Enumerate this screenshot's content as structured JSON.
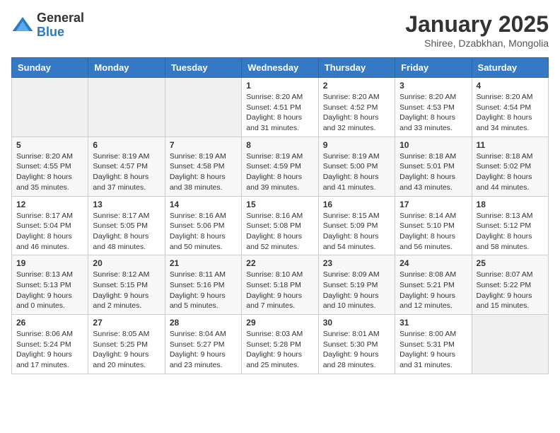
{
  "header": {
    "logo_general": "General",
    "logo_blue": "Blue",
    "month_title": "January 2025",
    "subtitle": "Shiree, Dzabkhan, Mongolia"
  },
  "days_of_week": [
    "Sunday",
    "Monday",
    "Tuesday",
    "Wednesday",
    "Thursday",
    "Friday",
    "Saturday"
  ],
  "weeks": [
    [
      {
        "day": "",
        "info": ""
      },
      {
        "day": "",
        "info": ""
      },
      {
        "day": "",
        "info": ""
      },
      {
        "day": "1",
        "info": "Sunrise: 8:20 AM\nSunset: 4:51 PM\nDaylight: 8 hours\nand 31 minutes."
      },
      {
        "day": "2",
        "info": "Sunrise: 8:20 AM\nSunset: 4:52 PM\nDaylight: 8 hours\nand 32 minutes."
      },
      {
        "day": "3",
        "info": "Sunrise: 8:20 AM\nSunset: 4:53 PM\nDaylight: 8 hours\nand 33 minutes."
      },
      {
        "day": "4",
        "info": "Sunrise: 8:20 AM\nSunset: 4:54 PM\nDaylight: 8 hours\nand 34 minutes."
      }
    ],
    [
      {
        "day": "5",
        "info": "Sunrise: 8:20 AM\nSunset: 4:55 PM\nDaylight: 8 hours\nand 35 minutes."
      },
      {
        "day": "6",
        "info": "Sunrise: 8:19 AM\nSunset: 4:57 PM\nDaylight: 8 hours\nand 37 minutes."
      },
      {
        "day": "7",
        "info": "Sunrise: 8:19 AM\nSunset: 4:58 PM\nDaylight: 8 hours\nand 38 minutes."
      },
      {
        "day": "8",
        "info": "Sunrise: 8:19 AM\nSunset: 4:59 PM\nDaylight: 8 hours\nand 39 minutes."
      },
      {
        "day": "9",
        "info": "Sunrise: 8:19 AM\nSunset: 5:00 PM\nDaylight: 8 hours\nand 41 minutes."
      },
      {
        "day": "10",
        "info": "Sunrise: 8:18 AM\nSunset: 5:01 PM\nDaylight: 8 hours\nand 43 minutes."
      },
      {
        "day": "11",
        "info": "Sunrise: 8:18 AM\nSunset: 5:02 PM\nDaylight: 8 hours\nand 44 minutes."
      }
    ],
    [
      {
        "day": "12",
        "info": "Sunrise: 8:17 AM\nSunset: 5:04 PM\nDaylight: 8 hours\nand 46 minutes."
      },
      {
        "day": "13",
        "info": "Sunrise: 8:17 AM\nSunset: 5:05 PM\nDaylight: 8 hours\nand 48 minutes."
      },
      {
        "day": "14",
        "info": "Sunrise: 8:16 AM\nSunset: 5:06 PM\nDaylight: 8 hours\nand 50 minutes."
      },
      {
        "day": "15",
        "info": "Sunrise: 8:16 AM\nSunset: 5:08 PM\nDaylight: 8 hours\nand 52 minutes."
      },
      {
        "day": "16",
        "info": "Sunrise: 8:15 AM\nSunset: 5:09 PM\nDaylight: 8 hours\nand 54 minutes."
      },
      {
        "day": "17",
        "info": "Sunrise: 8:14 AM\nSunset: 5:10 PM\nDaylight: 8 hours\nand 56 minutes."
      },
      {
        "day": "18",
        "info": "Sunrise: 8:13 AM\nSunset: 5:12 PM\nDaylight: 8 hours\nand 58 minutes."
      }
    ],
    [
      {
        "day": "19",
        "info": "Sunrise: 8:13 AM\nSunset: 5:13 PM\nDaylight: 9 hours\nand 0 minutes."
      },
      {
        "day": "20",
        "info": "Sunrise: 8:12 AM\nSunset: 5:15 PM\nDaylight: 9 hours\nand 2 minutes."
      },
      {
        "day": "21",
        "info": "Sunrise: 8:11 AM\nSunset: 5:16 PM\nDaylight: 9 hours\nand 5 minutes."
      },
      {
        "day": "22",
        "info": "Sunrise: 8:10 AM\nSunset: 5:18 PM\nDaylight: 9 hours\nand 7 minutes."
      },
      {
        "day": "23",
        "info": "Sunrise: 8:09 AM\nSunset: 5:19 PM\nDaylight: 9 hours\nand 10 minutes."
      },
      {
        "day": "24",
        "info": "Sunrise: 8:08 AM\nSunset: 5:21 PM\nDaylight: 9 hours\nand 12 minutes."
      },
      {
        "day": "25",
        "info": "Sunrise: 8:07 AM\nSunset: 5:22 PM\nDaylight: 9 hours\nand 15 minutes."
      }
    ],
    [
      {
        "day": "26",
        "info": "Sunrise: 8:06 AM\nSunset: 5:24 PM\nDaylight: 9 hours\nand 17 minutes."
      },
      {
        "day": "27",
        "info": "Sunrise: 8:05 AM\nSunset: 5:25 PM\nDaylight: 9 hours\nand 20 minutes."
      },
      {
        "day": "28",
        "info": "Sunrise: 8:04 AM\nSunset: 5:27 PM\nDaylight: 9 hours\nand 23 minutes."
      },
      {
        "day": "29",
        "info": "Sunrise: 8:03 AM\nSunset: 5:28 PM\nDaylight: 9 hours\nand 25 minutes."
      },
      {
        "day": "30",
        "info": "Sunrise: 8:01 AM\nSunset: 5:30 PM\nDaylight: 9 hours\nand 28 minutes."
      },
      {
        "day": "31",
        "info": "Sunrise: 8:00 AM\nSunset: 5:31 PM\nDaylight: 9 hours\nand 31 minutes."
      },
      {
        "day": "",
        "info": ""
      }
    ]
  ]
}
